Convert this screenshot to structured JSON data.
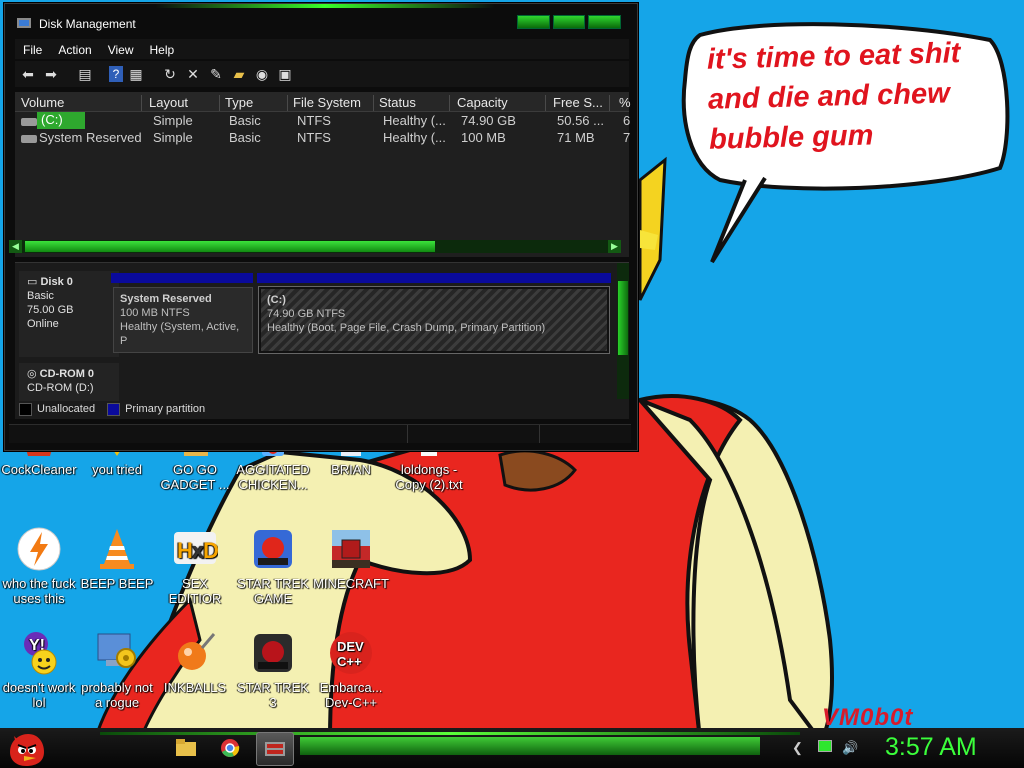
{
  "speech_bubble": {
    "line1": "it's time to eat shit",
    "line2": "and die and chew",
    "line3": "bubble gum"
  },
  "signature": "VM0b0t",
  "desktop_icons": [
    {
      "label": "CockCleaner",
      "icon": "ccleaner-icon"
    },
    {
      "label": "you tried",
      "icon": "gold-star-icon"
    },
    {
      "label": "GO GO GADGET ...",
      "icon": "folder-icon"
    },
    {
      "label": "AGGITATED CHICKEN...",
      "icon": "angry-birds-icon"
    },
    {
      "label": "BRIAN",
      "icon": "image-file-icon"
    },
    {
      "label": "loldongs - Copy (2).txt",
      "icon": "text-file-icon"
    },
    {
      "label": "who the fuck uses this",
      "icon": "winamp-bolt-icon"
    },
    {
      "label": "BEEP BEEP",
      "icon": "vlc-cone-icon"
    },
    {
      "label": "SEX EDITIOR",
      "icon": "hxd-editor-icon"
    },
    {
      "label": "STAR TREK GAME",
      "icon": "star-wars-game-icon"
    },
    {
      "label": "MINECRAFT",
      "icon": "minecraft-icon"
    },
    {
      "label": "doesn't work lol",
      "icon": "yahoo-messenger-icon"
    },
    {
      "label": "probably not a rogue",
      "icon": "system-gear-icon"
    },
    {
      "label": "INKBALLS",
      "icon": "inkball-icon"
    },
    {
      "label": "STAR TREK 3",
      "icon": "star-wars-game-icon"
    },
    {
      "label": "Embarca... Dev-C++",
      "icon": "dev-cpp-icon"
    }
  ],
  "window": {
    "title": "Disk Management",
    "menu": [
      "File",
      "Action",
      "View",
      "Help"
    ],
    "toolbar_icons": [
      "back-icon",
      "forward-icon",
      "console-tree-icon",
      "help-icon",
      "properties-icon",
      "refresh-icon",
      "delete-icon",
      "settings-icon",
      "open-folder-icon",
      "rescan-icon",
      "disk-list-icon"
    ],
    "columns": [
      "Volume",
      "Layout",
      "Type",
      "File System",
      "Status",
      "Capacity",
      "Free S...",
      "%"
    ],
    "rows": [
      {
        "volume": "(C:)",
        "layout": "Simple",
        "type": "Basic",
        "fs": "NTFS",
        "status": "Healthy (...",
        "capacity": "74.90 GB",
        "free": "50.56 ...",
        "pct": "6"
      },
      {
        "volume": "System Reserved",
        "layout": "Simple",
        "type": "Basic",
        "fs": "NTFS",
        "status": "Healthy (...",
        "capacity": "100 MB",
        "free": "71 MB",
        "pct": "7"
      }
    ],
    "disk0": {
      "name": "Disk 0",
      "type": "Basic",
      "size": "75.00 GB",
      "state": "Online",
      "p1_name": "System Reserved",
      "p1_size": "100 MB NTFS",
      "p1_status": "Healthy (System, Active, P",
      "p2_name": "(C:)",
      "p2_size": "74.90 GB NTFS",
      "p2_status": "Healthy (Boot, Page File, Crash Dump, Primary Partition)"
    },
    "cdrom": {
      "name": "CD-ROM 0",
      "detail": "CD-ROM (D:)"
    },
    "legend": {
      "unallocated": "Unallocated",
      "primary": "Primary partition",
      "unallocated_color": "#000000",
      "primary_color": "#0a0a9c"
    }
  },
  "taskbar": {
    "clock": "3:57 AM",
    "pinned": [
      "angry-birds-start-icon",
      "explorer-icon",
      "chrome-icon",
      "disk-management-icon"
    ],
    "tray": [
      "show-hidden-icon",
      "battery-icon",
      "volume-icon"
    ],
    "accent": "#3bff3b"
  }
}
